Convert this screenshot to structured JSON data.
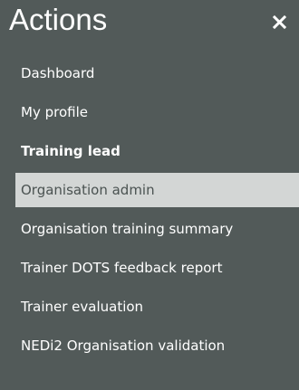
{
  "panel": {
    "title": "Actions",
    "close_icon": "close-icon"
  },
  "menu": {
    "items": [
      {
        "label": "Dashboard"
      },
      {
        "label": "My profile"
      },
      {
        "label": "Training lead"
      },
      {
        "label": "Organisation admin"
      },
      {
        "label": "Organisation training summary"
      },
      {
        "label": "Trainer DOTS feedback report"
      },
      {
        "label": "Trainer evaluation"
      },
      {
        "label": "NEDi2 Organisation validation"
      }
    ],
    "active_item": "Organisation admin",
    "heading_item": "Training lead"
  },
  "colors": {
    "panel_background": "#525a59",
    "active_background": "#d3d6d5",
    "active_text": "#4a5251",
    "text": "#ffffff"
  }
}
